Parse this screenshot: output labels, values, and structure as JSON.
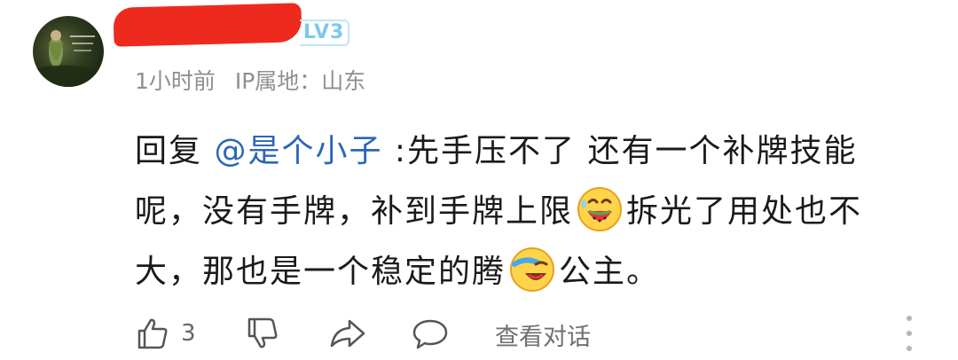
{
  "comment": {
    "author": {
      "level_badge": "LV3"
    },
    "meta": {
      "time": "1小时前",
      "ip_location": "IP属地：山东"
    },
    "reply_prefix": "回复 ",
    "mention": "@是个小子",
    "text_part1": " :先手压不了  还有一个补牌技能呢，没有手牌，补到手牌上限",
    "text_part2": "拆光了用处也不大，那也是一个稳定的腾",
    "text_part3": "公主。",
    "emojis": [
      "watermelon-laugh-emoji",
      "laughing-cry-emoji"
    ]
  },
  "actions": {
    "like_icon": "thumbs-up-icon",
    "like_count": "3",
    "dislike_icon": "thumbs-down-icon",
    "share_icon": "share-arrow-icon",
    "reply_icon": "speech-bubble-icon",
    "view_thread_label": "查看对话",
    "more_icon": "more-vertical-icon"
  },
  "colors": {
    "mention": "#2c66b8",
    "meta_text": "#8f8f8f",
    "level_badge": "#7ec8ee",
    "redaction": "#ee2a1f"
  }
}
